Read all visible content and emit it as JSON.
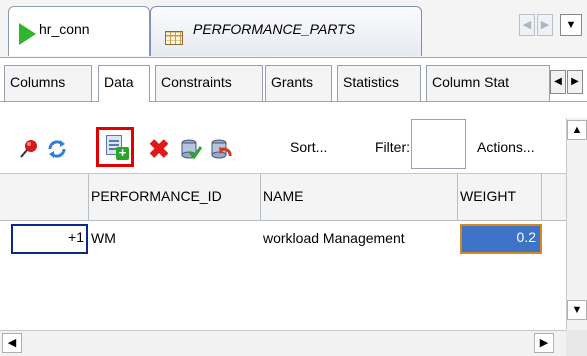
{
  "document_tabs": [
    {
      "label": "hr_conn",
      "icon": "connection-play-icon"
    },
    {
      "label": "PERFORMANCE_PARTS",
      "icon": "table-grid-icon"
    }
  ],
  "editor_tabs": [
    "Columns",
    "Data",
    "Constraints",
    "Grants",
    "Statistics",
    "Column Stat"
  ],
  "active_editor_tab": "Data",
  "toolbar": {
    "icons": [
      "freeze-pin-icon",
      "refresh-icon",
      "insert-row-icon",
      "delete-row-icon",
      "commit-icon",
      "rollback-icon"
    ],
    "highlighted": "insert-row-icon",
    "sort_label": "Sort...",
    "filter_label": "Filter:",
    "filter_value": "",
    "actions_label": "Actions..."
  },
  "grid": {
    "columns": [
      "PERFORMANCE_ID",
      "NAME",
      "WEIGHT"
    ],
    "rows": [
      {
        "row_number": "+1",
        "PERFORMANCE_ID": "WM",
        "NAME": "workload Management",
        "WEIGHT": "0.2"
      }
    ]
  },
  "colors": {
    "selected_cell_bg": "#3e73c8",
    "selected_cell_border": "#d08a20",
    "highlight_box": "#e00000",
    "connection_icon": "#2fb62f"
  }
}
